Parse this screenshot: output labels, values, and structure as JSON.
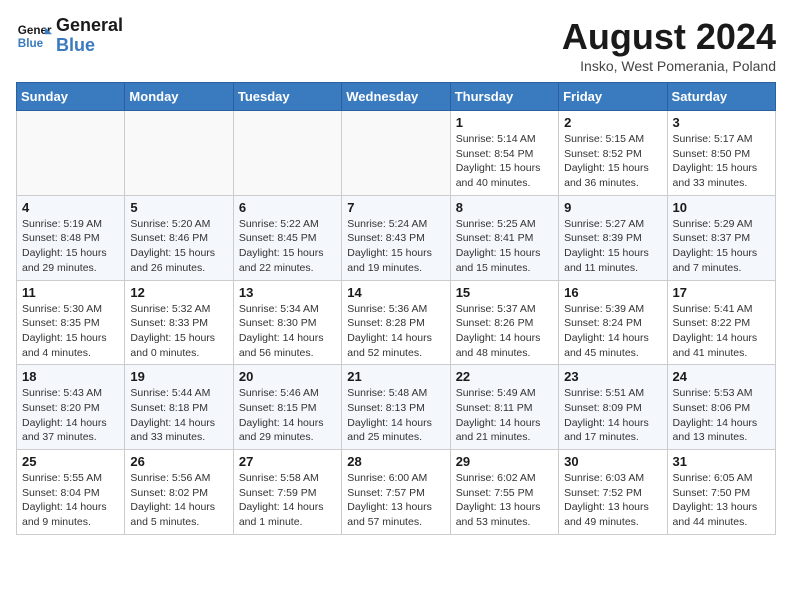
{
  "header": {
    "logo_line1": "General",
    "logo_line2": "Blue",
    "month_year": "August 2024",
    "location": "Insko, West Pomerania, Poland"
  },
  "weekdays": [
    "Sunday",
    "Monday",
    "Tuesday",
    "Wednesday",
    "Thursday",
    "Friday",
    "Saturday"
  ],
  "weeks": [
    [
      {
        "day": "",
        "info": ""
      },
      {
        "day": "",
        "info": ""
      },
      {
        "day": "",
        "info": ""
      },
      {
        "day": "",
        "info": ""
      },
      {
        "day": "1",
        "info": "Sunrise: 5:14 AM\nSunset: 8:54 PM\nDaylight: 15 hours and 40 minutes."
      },
      {
        "day": "2",
        "info": "Sunrise: 5:15 AM\nSunset: 8:52 PM\nDaylight: 15 hours and 36 minutes."
      },
      {
        "day": "3",
        "info": "Sunrise: 5:17 AM\nSunset: 8:50 PM\nDaylight: 15 hours and 33 minutes."
      }
    ],
    [
      {
        "day": "4",
        "info": "Sunrise: 5:19 AM\nSunset: 8:48 PM\nDaylight: 15 hours and 29 minutes."
      },
      {
        "day": "5",
        "info": "Sunrise: 5:20 AM\nSunset: 8:46 PM\nDaylight: 15 hours and 26 minutes."
      },
      {
        "day": "6",
        "info": "Sunrise: 5:22 AM\nSunset: 8:45 PM\nDaylight: 15 hours and 22 minutes."
      },
      {
        "day": "7",
        "info": "Sunrise: 5:24 AM\nSunset: 8:43 PM\nDaylight: 15 hours and 19 minutes."
      },
      {
        "day": "8",
        "info": "Sunrise: 5:25 AM\nSunset: 8:41 PM\nDaylight: 15 hours and 15 minutes."
      },
      {
        "day": "9",
        "info": "Sunrise: 5:27 AM\nSunset: 8:39 PM\nDaylight: 15 hours and 11 minutes."
      },
      {
        "day": "10",
        "info": "Sunrise: 5:29 AM\nSunset: 8:37 PM\nDaylight: 15 hours and 7 minutes."
      }
    ],
    [
      {
        "day": "11",
        "info": "Sunrise: 5:30 AM\nSunset: 8:35 PM\nDaylight: 15 hours and 4 minutes."
      },
      {
        "day": "12",
        "info": "Sunrise: 5:32 AM\nSunset: 8:33 PM\nDaylight: 15 hours and 0 minutes."
      },
      {
        "day": "13",
        "info": "Sunrise: 5:34 AM\nSunset: 8:30 PM\nDaylight: 14 hours and 56 minutes."
      },
      {
        "day": "14",
        "info": "Sunrise: 5:36 AM\nSunset: 8:28 PM\nDaylight: 14 hours and 52 minutes."
      },
      {
        "day": "15",
        "info": "Sunrise: 5:37 AM\nSunset: 8:26 PM\nDaylight: 14 hours and 48 minutes."
      },
      {
        "day": "16",
        "info": "Sunrise: 5:39 AM\nSunset: 8:24 PM\nDaylight: 14 hours and 45 minutes."
      },
      {
        "day": "17",
        "info": "Sunrise: 5:41 AM\nSunset: 8:22 PM\nDaylight: 14 hours and 41 minutes."
      }
    ],
    [
      {
        "day": "18",
        "info": "Sunrise: 5:43 AM\nSunset: 8:20 PM\nDaylight: 14 hours and 37 minutes."
      },
      {
        "day": "19",
        "info": "Sunrise: 5:44 AM\nSunset: 8:18 PM\nDaylight: 14 hours and 33 minutes."
      },
      {
        "day": "20",
        "info": "Sunrise: 5:46 AM\nSunset: 8:15 PM\nDaylight: 14 hours and 29 minutes."
      },
      {
        "day": "21",
        "info": "Sunrise: 5:48 AM\nSunset: 8:13 PM\nDaylight: 14 hours and 25 minutes."
      },
      {
        "day": "22",
        "info": "Sunrise: 5:49 AM\nSunset: 8:11 PM\nDaylight: 14 hours and 21 minutes."
      },
      {
        "day": "23",
        "info": "Sunrise: 5:51 AM\nSunset: 8:09 PM\nDaylight: 14 hours and 17 minutes."
      },
      {
        "day": "24",
        "info": "Sunrise: 5:53 AM\nSunset: 8:06 PM\nDaylight: 14 hours and 13 minutes."
      }
    ],
    [
      {
        "day": "25",
        "info": "Sunrise: 5:55 AM\nSunset: 8:04 PM\nDaylight: 14 hours and 9 minutes."
      },
      {
        "day": "26",
        "info": "Sunrise: 5:56 AM\nSunset: 8:02 PM\nDaylight: 14 hours and 5 minutes."
      },
      {
        "day": "27",
        "info": "Sunrise: 5:58 AM\nSunset: 7:59 PM\nDaylight: 14 hours and 1 minute."
      },
      {
        "day": "28",
        "info": "Sunrise: 6:00 AM\nSunset: 7:57 PM\nDaylight: 13 hours and 57 minutes."
      },
      {
        "day": "29",
        "info": "Sunrise: 6:02 AM\nSunset: 7:55 PM\nDaylight: 13 hours and 53 minutes."
      },
      {
        "day": "30",
        "info": "Sunrise: 6:03 AM\nSunset: 7:52 PM\nDaylight: 13 hours and 49 minutes."
      },
      {
        "day": "31",
        "info": "Sunrise: 6:05 AM\nSunset: 7:50 PM\nDaylight: 13 hours and 44 minutes."
      }
    ]
  ]
}
